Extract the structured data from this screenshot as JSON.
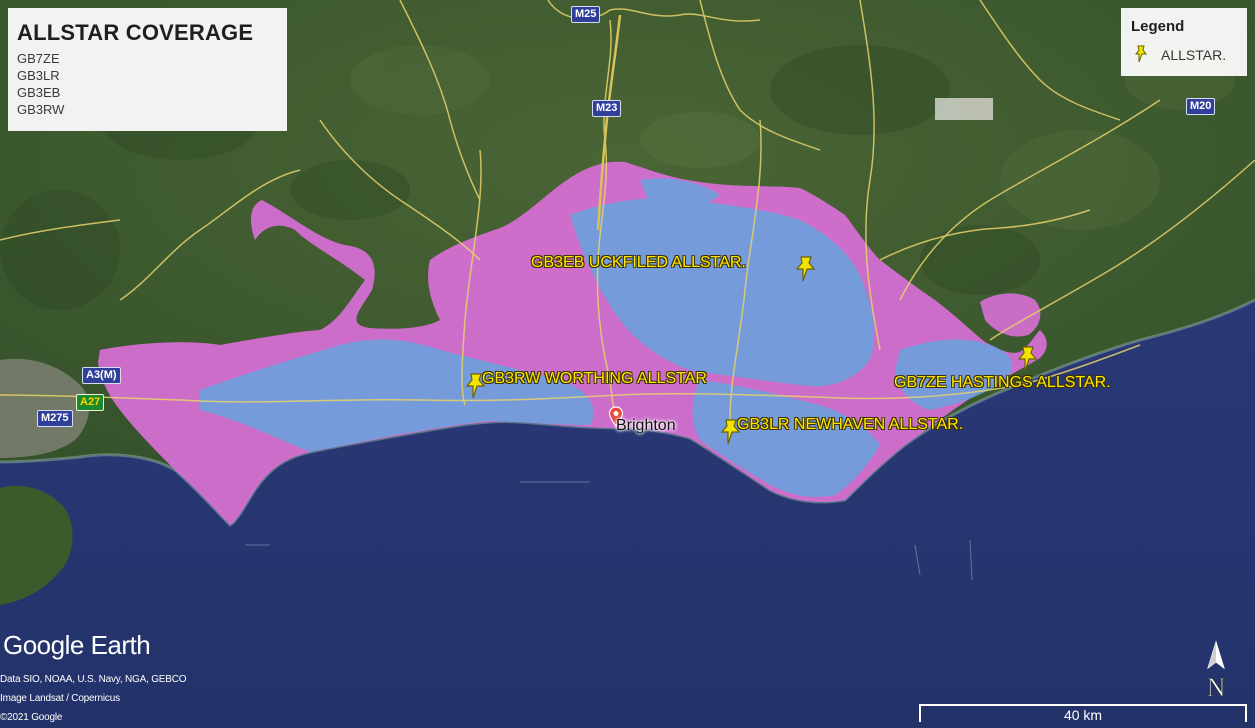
{
  "title_box": {
    "title": "ALLSTAR COVERAGE",
    "items": [
      "GB7ZE",
      "GB3LR",
      "GB3EB",
      "GB3RW"
    ]
  },
  "legend": {
    "title": "Legend",
    "entry_label": "ALLSTAR.",
    "entry_icon": "yellow-pushpin-icon"
  },
  "placemarks": [
    {
      "id": "eb",
      "label": "GB3EB UCKFILED ALLSTAR."
    },
    {
      "id": "rw",
      "label": "GB3RW WORTHING ALLSTAR"
    },
    {
      "id": "ze",
      "label": "GB7ZE HASTINGS ALLSTAR."
    },
    {
      "id": "lr",
      "label": "GB3LR NEWHAVEN ALLSTAR."
    }
  ],
  "city": {
    "label": "Brighton"
  },
  "road_shields": {
    "m25": "M25",
    "m23": "M23",
    "m20": "M20",
    "a3m": "A3(M)",
    "a27": "A27",
    "m275": "M275"
  },
  "branding": "Google Earth",
  "attribution": {
    "line1": "Data SIO, NOAA, U.S. Navy, NGA, GEBCO",
    "line2": "Image Landsat / Copernicus",
    "line3": "©2021 Google"
  },
  "scale": {
    "label": "40 km"
  },
  "compass": {
    "label": "N"
  },
  "colors": {
    "sea": "#2b3a78",
    "land": "#3e5a2c",
    "coverage_magenta": "#d86fd6",
    "coverage_blue": "#6aa2dd",
    "label_yellow": "#ffe600",
    "road_yellow": "#e6d36a"
  }
}
